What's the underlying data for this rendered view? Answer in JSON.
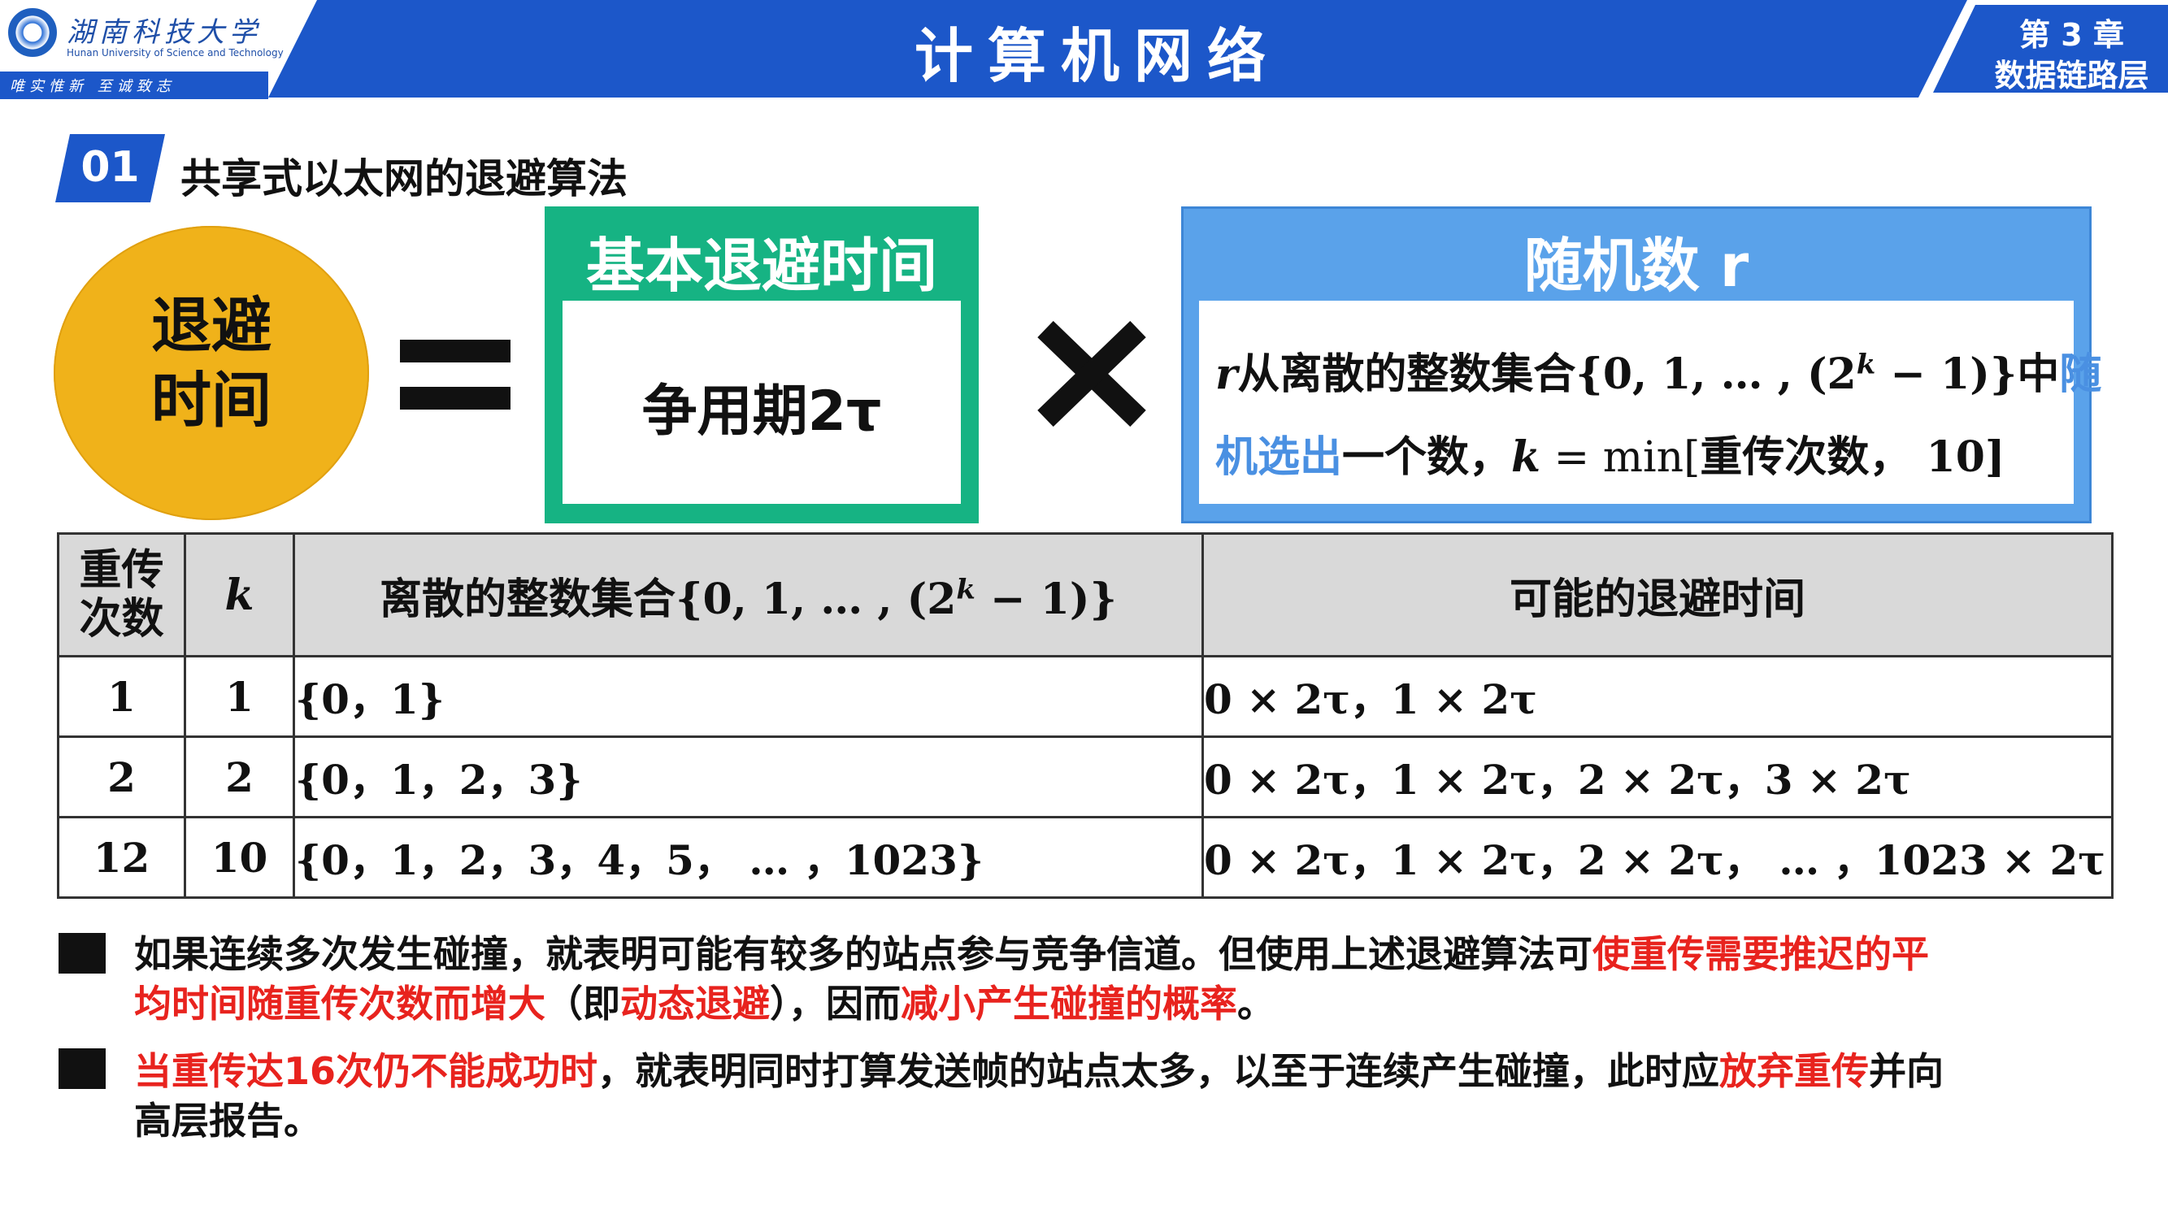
{
  "header": {
    "university_name": "湖南科技大学",
    "university_en": "Hunan University of Science and Technology",
    "motto": "唯实惟新  至诚致志",
    "course_title": "计算机网络",
    "chapter_line1": "第 3 章",
    "chapter_line2": "数据链路层"
  },
  "section": {
    "number": "01",
    "title": "共享式以太网的退避算法"
  },
  "formula": {
    "circle_line1": "退避",
    "circle_line2": "时间",
    "green_title": "基本退避时间",
    "green_content": "争用期2τ",
    "blue_title": "随机数 r",
    "blue_line1_a": "r",
    "blue_line1_b": "从离散的整数集合",
    "blue_line1_c": "{0, 1, … , (2",
    "blue_line1_sup": "k",
    "blue_line1_d": " − 1)}",
    "blue_line1_e": "中",
    "blue_line1_f": "随",
    "blue_line2_a": "机选出",
    "blue_line2_b": "一个数，",
    "blue_line2_c": "k",
    "blue_line2_d": " = min[",
    "blue_line2_e": "重传次数，",
    "blue_line2_f": " 10]"
  },
  "table": {
    "headers": {
      "col1_line1": "重传",
      "col1_line2": "次数",
      "col2": "k",
      "col3_text": "离散的整数集合",
      "col3_math_a": "{0, 1, … , (2",
      "col3_sup": "k",
      "col3_math_b": " − 1)}",
      "col4": "可能的退避时间"
    },
    "rows": [
      {
        "retries": "1",
        "k": "1",
        "set": "{0，1}",
        "times": "0 × 2τ，1 × 2τ"
      },
      {
        "retries": "2",
        "k": "2",
        "set": "{0，1，2，3}",
        "times": "0 × 2τ，1 × 2τ，2 × 2τ，3 × 2τ"
      },
      {
        "retries": "12",
        "k": "10",
        "set": "{0，1，2，3，4，5，  …  ，1023}",
        "times": "0 × 2τ，1 × 2τ，2 × 2τ，  …  ，1023 × 2τ"
      }
    ]
  },
  "notes": {
    "n1_a": "如果连续多次发生碰撞，就表明可能有较多的站点参与竞争信道。但使用上述退避算法可",
    "n1_b": "使重传需要推迟的平",
    "n1_c": "均时间随重传次数而增大",
    "n1_d": "（即",
    "n1_e": "动态退避",
    "n1_f": "），因而",
    "n1_g": "减小产生碰撞的概率",
    "n1_h": "。",
    "n2_a": "当重传达16次仍不能成功时",
    "n2_b": "，就表明同时打算发送帧的站点太多，以至于连续产生碰撞，此时应",
    "n2_c": "放弃重传",
    "n2_d": "并向",
    "n2_e": "高层报告。"
  },
  "colors": {
    "header_blue": "#1c57c9",
    "circle_yellow": "#f0b21a",
    "green": "#16b383",
    "light_blue": "#5aa2ea",
    "highlight_red": "#e8231e",
    "highlight_blue": "#4a90e2"
  }
}
